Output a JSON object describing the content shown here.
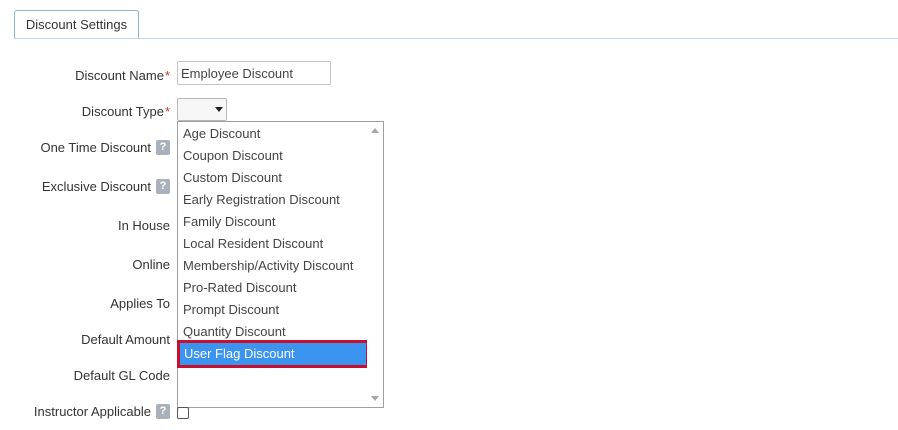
{
  "tab": {
    "label": "Discount Settings"
  },
  "form": {
    "discount_name": {
      "label": "Discount Name",
      "required": "*",
      "value": "Employee Discount"
    },
    "discount_type": {
      "label": "Discount Type",
      "required": "*",
      "value": ""
    },
    "one_time_discount": {
      "label": "One Time Discount",
      "help": "?"
    },
    "exclusive_discount": {
      "label": "Exclusive Discount",
      "help": "?"
    },
    "in_house": {
      "label": "In House"
    },
    "online": {
      "label": "Online"
    },
    "applies_to": {
      "label": "Applies To"
    },
    "default_amount": {
      "label": "Default Amount"
    },
    "default_gl_code": {
      "label": "Default GL Code"
    },
    "instructor_applicable": {
      "label": "Instructor Applicable",
      "help": "?"
    }
  },
  "dropdown": {
    "options": [
      "Age Discount",
      "Coupon Discount",
      "Custom Discount",
      "Early Registration Discount",
      "Family Discount",
      "Local Resident Discount",
      "Membership/Activity Discount",
      "Pro-Rated Discount",
      "Prompt Discount",
      "Quantity Discount",
      "User Flag Discount"
    ],
    "highlighted": "User Flag Discount"
  },
  "colors": {
    "highlight": "#3b94f0",
    "annotation": "#c8102e",
    "required": "#c0392b"
  }
}
